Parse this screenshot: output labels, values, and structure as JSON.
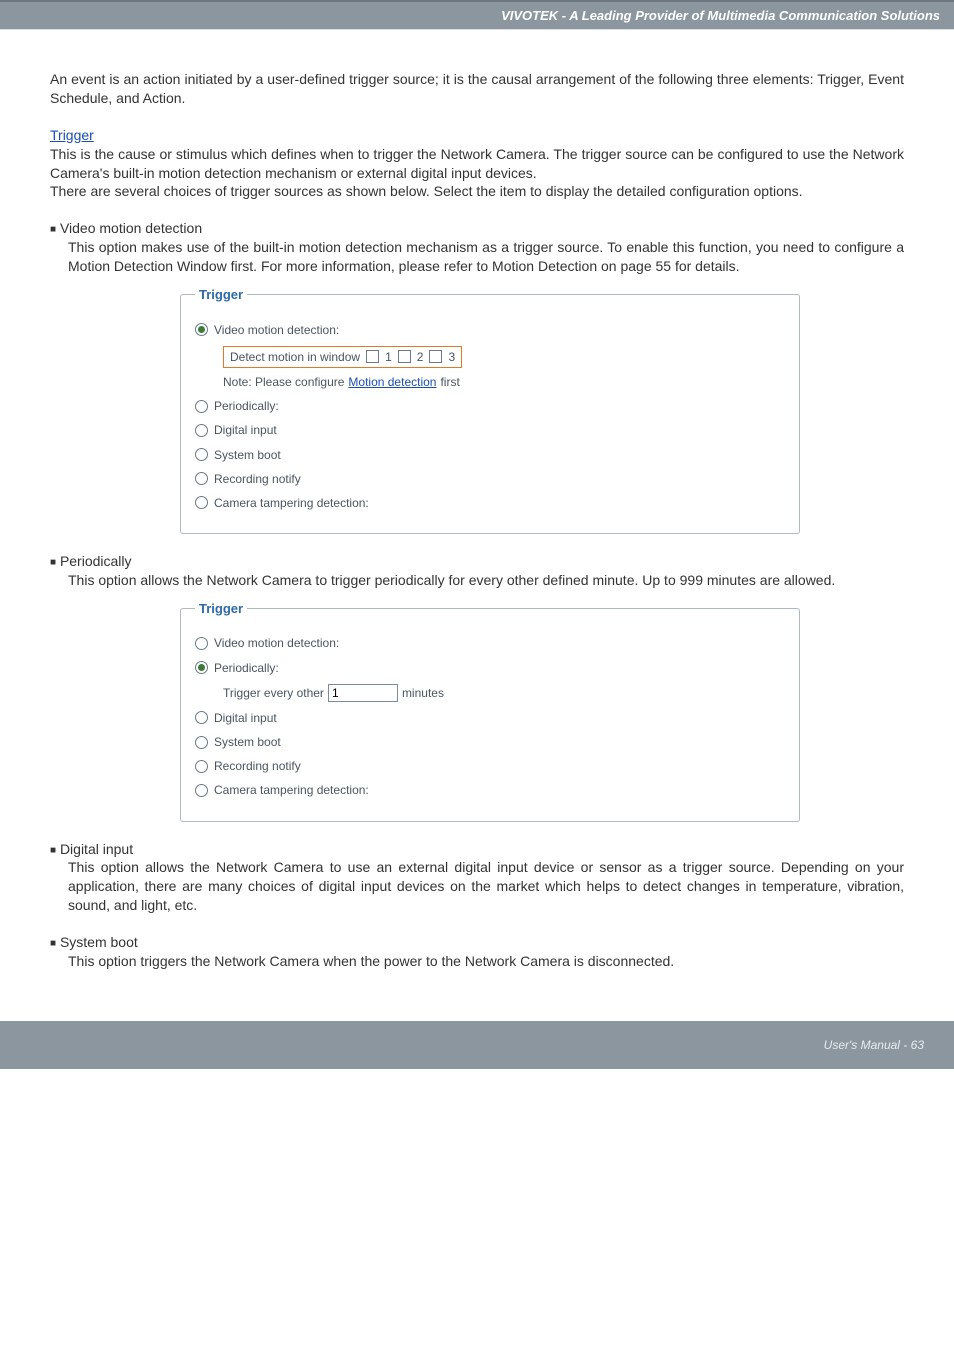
{
  "header": {
    "title": "VIVOTEK - A Leading Provider of Multimedia Communication Solutions"
  },
  "intro": {
    "p1": "An event is an action initiated by a user-defined trigger source; it is the causal arrangement of the following three elements: Trigger, Event Schedule, and Action."
  },
  "trigger_section": {
    "heading": "Trigger",
    "p1": "This is the cause or stimulus which defines when to trigger the Network Camera. The trigger source can be configured to use the Network Camera's built-in motion detection mechanism or external digital input devices.",
    "p2": "There are several choices of trigger sources as shown below. Select the item to display the detailed configuration options."
  },
  "vmd": {
    "bullet": "Video motion detection",
    "desc": "This option makes use of the built-in motion detection mechanism as a trigger source. To enable this function, you need to configure a Motion Detection Window first. For more information, please refer to Motion Detection on page 55 for details."
  },
  "periodically": {
    "bullet": "Periodically",
    "desc": "This option allows the Network Camera to trigger periodically for every other defined minute. Up to 999 minutes are allowed."
  },
  "digital_input": {
    "bullet": "Digital input",
    "desc": "This option allows the Network Camera to use an external digital input device or sensor as a trigger source. Depending on your application, there are many choices of digital input devices on the market which helps to detect changes in temperature, vibration, sound, and light, etc."
  },
  "system_boot": {
    "bullet": "System boot",
    "desc": "This option triggers the Network Camera when the power to the Network Camera is disconnected."
  },
  "shot1": {
    "legend": "Trigger",
    "o_vmd": "Video motion detection:",
    "detect_label": "Detect motion in window",
    "w1": "1",
    "w2": "2",
    "w3": "3",
    "note_prefix": "Note: Please configure ",
    "note_link": "Motion detection",
    "note_suffix": " first",
    "o_period": "Periodically:",
    "o_digital": "Digital input",
    "o_sysboot": "System boot",
    "o_rec": "Recording notify",
    "o_tamper": "Camera tampering detection:"
  },
  "shot2": {
    "legend": "Trigger",
    "o_vmd": "Video motion detection:",
    "o_period": "Periodically:",
    "every_prefix": "Trigger every other",
    "every_value": "1",
    "every_suffix": "minutes",
    "o_digital": "Digital input",
    "o_sysboot": "System boot",
    "o_rec": "Recording notify",
    "o_tamper": "Camera tampering detection:"
  },
  "footer": {
    "pagenum": "User's Manual - 63"
  }
}
